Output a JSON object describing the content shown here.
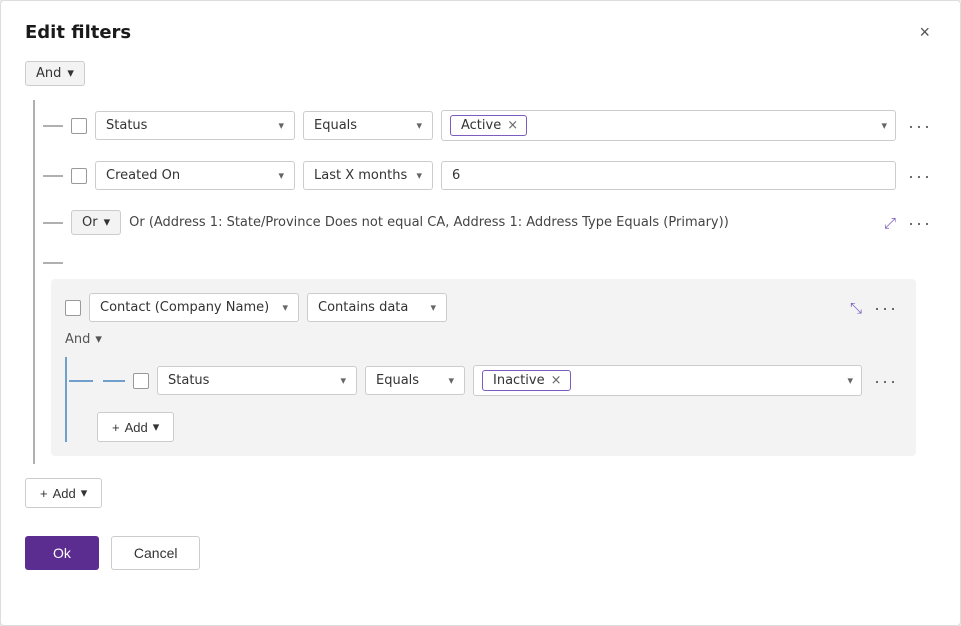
{
  "dialog": {
    "title": "Edit filters",
    "close_label": "×"
  },
  "top_operator": {
    "label": "And",
    "chevron": "▾"
  },
  "rows": [
    {
      "id": "row1",
      "field": "Status",
      "condition": "Equals",
      "value_tag": "Active",
      "value_placeholder": "",
      "has_tag": true,
      "more": "···"
    },
    {
      "id": "row2",
      "field": "Created On",
      "condition": "Last X months",
      "value_tag": "",
      "value_input": "6",
      "has_tag": false,
      "more": "···"
    }
  ],
  "or_group": {
    "operator": "Or",
    "operator_chevron": "▾",
    "description": "Or (Address 1: State/Province Does not equal CA, Address 1: Address Type Equals (Primary))",
    "expand_icon": "⤢",
    "more": "···"
  },
  "nested_group": {
    "field": "Contact (Company Name)",
    "field_chevron": "▾",
    "condition": "Contains data",
    "condition_chevron": "▾",
    "collapse_icon": "⤡",
    "more": "···",
    "and_operator": "And",
    "and_chevron": "▾",
    "sub_row": {
      "field": "Status",
      "condition": "Equals",
      "value_tag": "Inactive",
      "more": "···"
    },
    "add_label": "Add",
    "add_plus": "+",
    "add_chevron": "▾"
  },
  "bottom_add": {
    "label": "Add",
    "plus": "+",
    "chevron": "▾"
  },
  "footer": {
    "ok_label": "Ok",
    "cancel_label": "Cancel"
  }
}
